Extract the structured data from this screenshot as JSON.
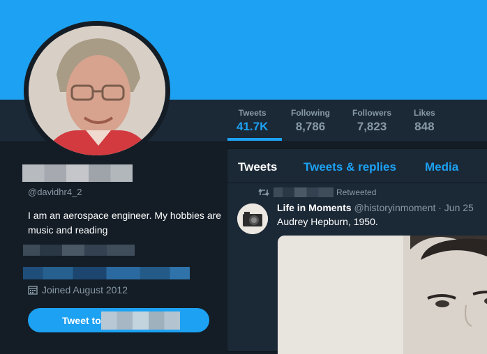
{
  "profile": {
    "handle": "@davidhr4_2",
    "bio": "I am an aerospace engineer. My hobbies are music and reading",
    "joined": "Joined August 2012",
    "tweet_to_label": "Tweet to"
  },
  "stats": [
    {
      "label": "Tweets",
      "value": "41.7K"
    },
    {
      "label": "Following",
      "value": "8,786"
    },
    {
      "label": "Followers",
      "value": "7,823"
    },
    {
      "label": "Likes",
      "value": "848"
    }
  ],
  "tabs": {
    "tweets": "Tweets",
    "replies": "Tweets & replies",
    "media": "Media"
  },
  "tweet": {
    "retweeted_label": "Retweeted",
    "name": "Life in Moments",
    "handle_date": "@historyinmoment · Jun 25",
    "text": "Audrey Hepburn, 1950."
  },
  "colors": {
    "accent": "#1da1f2",
    "background": "#141d26",
    "panel": "#1b2836",
    "muted": "#8899a6"
  },
  "icons": [
    "calendar-icon",
    "retweet-icon"
  ]
}
